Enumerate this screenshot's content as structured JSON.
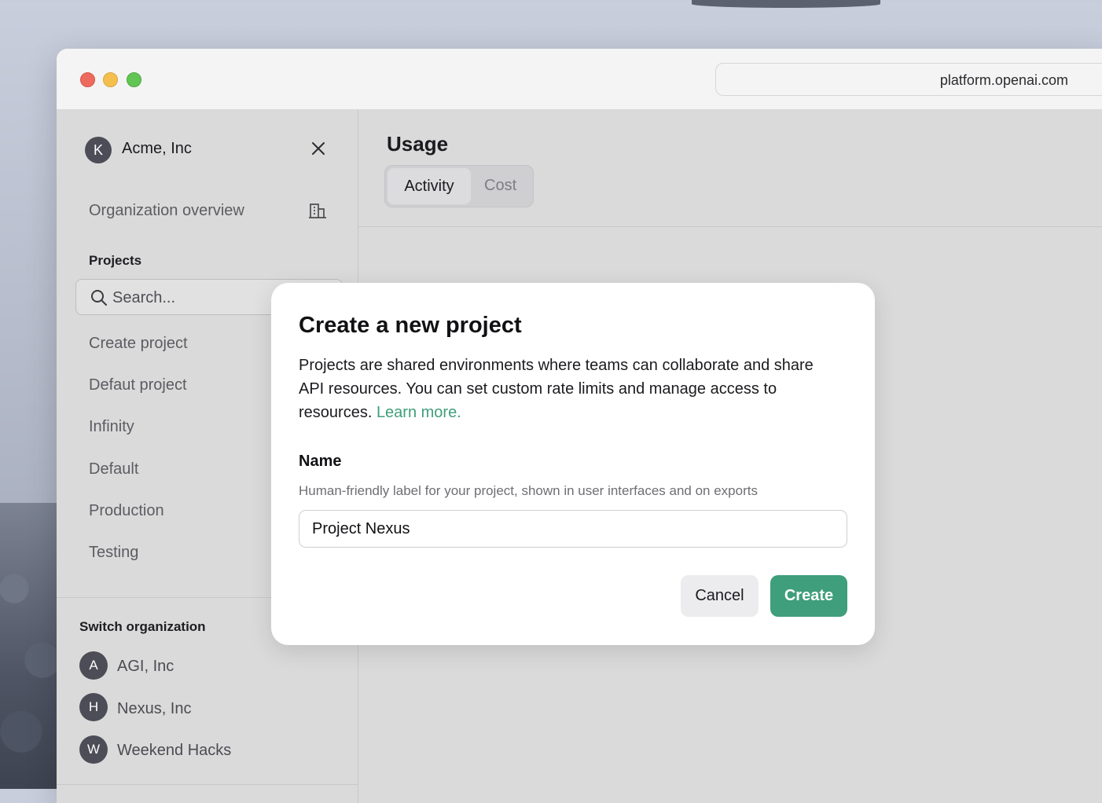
{
  "browser": {
    "url": "platform.openai.com"
  },
  "sidebar": {
    "org": {
      "initial": "K",
      "name": "Acme, Inc"
    },
    "overview_label": "Organization overview",
    "projects_heading": "Projects",
    "search_placeholder": "Search...",
    "project_items": [
      "Create project",
      "Defaut project",
      "Infinity",
      "Default",
      "Production",
      "Testing"
    ],
    "switch_heading": "Switch organization",
    "switch_orgs": [
      {
        "initial": "A",
        "name": "AGI, Inc"
      },
      {
        "initial": "H",
        "name": "Nexus, Inc"
      },
      {
        "initial": "W",
        "name": "Weekend Hacks"
      }
    ]
  },
  "main": {
    "title": "Usage",
    "tabs": [
      {
        "label": "Activity",
        "active": true
      },
      {
        "label": "Cost",
        "active": false
      }
    ]
  },
  "modal": {
    "title": "Create a new project",
    "description": "Projects are shared environments where teams can collaborate and share API resources. You can set custom rate limits and manage access to resources.",
    "learn_more": "Learn more.",
    "name_label": "Name",
    "name_help": "Human-friendly label for your project, shown in user interfaces and on exports",
    "name_value": "Project Nexus",
    "cancel_label": "Cancel",
    "create_label": "Create"
  },
  "colors": {
    "accent": "#3f9e7b",
    "avatar": "#4d4d58"
  }
}
